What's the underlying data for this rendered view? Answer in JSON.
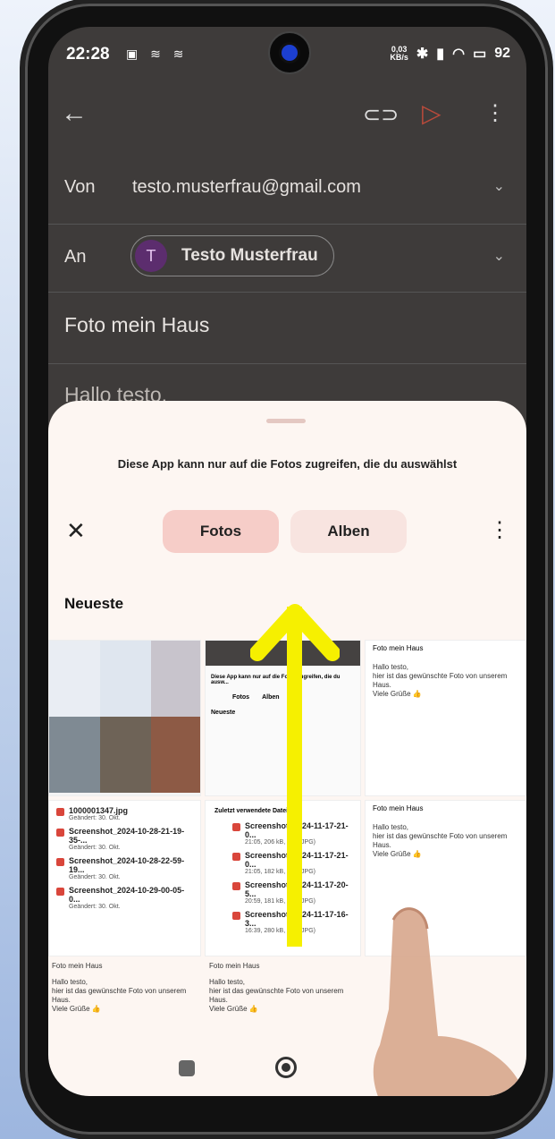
{
  "status": {
    "time": "22:28",
    "notif_icons": "▣ ≋ ≋",
    "net_speed_value": "0,03",
    "net_speed_unit": "KB/s",
    "battery": "92"
  },
  "icons": {
    "back": "←",
    "attach": "⊂⊃",
    "send": "▷",
    "more": "⋮",
    "chevron": "⌄",
    "close": "✕"
  },
  "email": {
    "from_label": "Von",
    "from_value": "testo.musterfrau@gmail.com",
    "to_label": "An",
    "to_initial": "T",
    "to_name": "Testo Musterfrau",
    "subject": "Foto mein Haus",
    "body_start": "Hallo testo,"
  },
  "picker": {
    "notice": "Diese App kann nur auf die Fotos zugreifen, die du auswählst",
    "tabs": [
      "Fotos",
      "Alben"
    ],
    "section_title": "Neueste"
  },
  "thumbnails": {
    "t1_files": [
      {
        "name": "1000001347.jpg",
        "meta": "Geändert: 30. Okt."
      },
      {
        "name": "Screenshot_2024-10-28-21-19-35-...",
        "meta": "Geändert: 30. Okt."
      },
      {
        "name": "Screenshot_2024-10-28-22-59-19...",
        "meta": "Geändert: 30. Okt."
      },
      {
        "name": "Screenshot_2024-10-29-00-05-0...",
        "meta": "Geändert: 30. Okt."
      }
    ],
    "t2_heading": "Zuletzt verwendete Dateien",
    "t2_files": [
      {
        "name": "Screenshot_2024-11-17-21-0...",
        "meta": "21:05, 206 kB, Bild (JPG)"
      },
      {
        "name": "Screenshot_2024-11-17-21-0...",
        "meta": "21:05, 182 kB, Bild (JPG)"
      },
      {
        "name": "Screenshot_2024-11-17-20-5...",
        "meta": "20:59, 181 kB, Bild (JPG)"
      },
      {
        "name": "Screenshot_2024-11-17-16-3...",
        "meta": "16:39, 280 kB, Bild (JPG)"
      }
    ],
    "mini_notice": "Diese App kann nur auf die Fotos zugreifen, die du ausw...",
    "mini_tabs": [
      "Fotos",
      "Alben"
    ],
    "mini_section": "Neueste",
    "email_subject": "Foto mein Haus",
    "email_lines": [
      "Hallo testo,",
      "hier ist das gewünschte Foto von unserem",
      "Haus.",
      "Viele Grüße 👍"
    ],
    "bottom_subjects": [
      "Foto mein Haus",
      "Foto mein Haus"
    ]
  }
}
